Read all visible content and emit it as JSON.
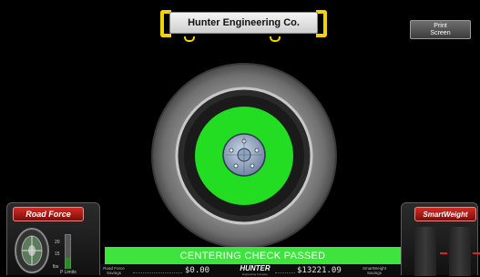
{
  "header": {
    "title": "Hunter Engineering Co."
  },
  "toolbar": {
    "print_line1": "Print",
    "print_line2": "Screen"
  },
  "status": {
    "message": "CENTERING CHECK PASSED",
    "color": "#3ee33e"
  },
  "left_panel": {
    "badge": "Road Force",
    "ticks": [
      "20",
      "15",
      "lbs"
    ],
    "footer": "P Limits"
  },
  "right_panel": {
    "badge": "SmartWeight"
  },
  "bottom": {
    "road_force_label": "Road Force",
    "road_force_sub": "Savings",
    "left_value": "$0.00",
    "logo": "HUNTER",
    "logo_sub": "Engineering Company",
    "right_value": "$13221.09",
    "smartweight_label": "SmartWeight",
    "smartweight_sub": "Savings"
  },
  "colors": {
    "accent": "#f2d400",
    "badge_red": "#c0261d",
    "wheel_green": "#22dd22"
  }
}
